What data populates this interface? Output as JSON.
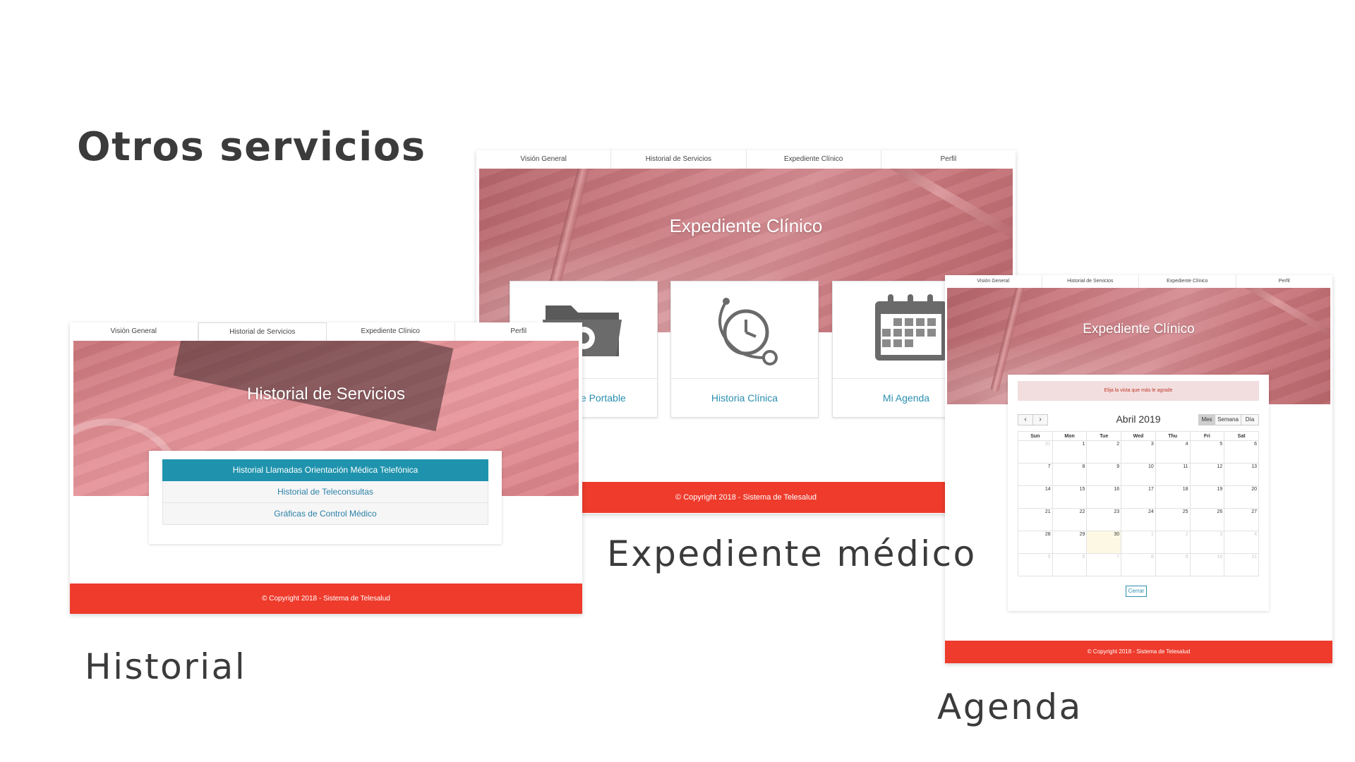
{
  "slide_title": "Otros servicios",
  "captions": {
    "historial": "Historial",
    "expediente": "Expediente médico",
    "agenda": "Agenda"
  },
  "nav_tabs": [
    "Visión General",
    "Historial de Servicios",
    "Expediente Clínico",
    "Perfil"
  ],
  "historial_screen": {
    "hero_title": "Historial de Servicios",
    "items": [
      "Historial Llamadas Orientación Médica Telefónica",
      "Historial de Teleconsultas",
      "Gráficas de Control Médico"
    ],
    "footer": "© Copyright 2018 - Sistema de Telesalud"
  },
  "expediente_screen": {
    "hero_title": "Expediente Clínico",
    "cards": [
      {
        "label": "te Portable",
        "icon": "folder-gear-icon"
      },
      {
        "label": "Historia Clínica",
        "icon": "stethoscope-clock-icon"
      },
      {
        "label": "Mi Agenda",
        "icon": "calendar-icon"
      }
    ],
    "footer": "© Copyright 2018 - Sistema de Telesalud"
  },
  "agenda_screen": {
    "hero_title": "Expediente Clínico",
    "alert": "Elija la vista que más le agrade",
    "prev": "‹",
    "next": "›",
    "month_title": "Abril 2019",
    "views": [
      "Mes",
      "Semana",
      "Día"
    ],
    "weekdays": [
      "Sun",
      "Mon",
      "Tue",
      "Wed",
      "Thu",
      "Fri",
      "Sat"
    ],
    "weeks": [
      [
        "31",
        "1",
        "2",
        "3",
        "4",
        "5",
        "6"
      ],
      [
        "7",
        "8",
        "9",
        "10",
        "11",
        "12",
        "13"
      ],
      [
        "14",
        "15",
        "16",
        "17",
        "18",
        "19",
        "20"
      ],
      [
        "21",
        "22",
        "23",
        "24",
        "25",
        "26",
        "27"
      ],
      [
        "28",
        "29",
        "30",
        "1",
        "2",
        "3",
        "4"
      ],
      [
        "5",
        "6",
        "7",
        "8",
        "9",
        "10",
        "11"
      ]
    ],
    "close_label": "Cerrar",
    "footer": "© Copyright 2018 - Sistema de Telesalud"
  },
  "colors": {
    "footer_red": "#ee3b2c",
    "active_teal": "#1f93ad",
    "link_blue": "#2b8fb0",
    "hero_pink": "#c97a80"
  }
}
